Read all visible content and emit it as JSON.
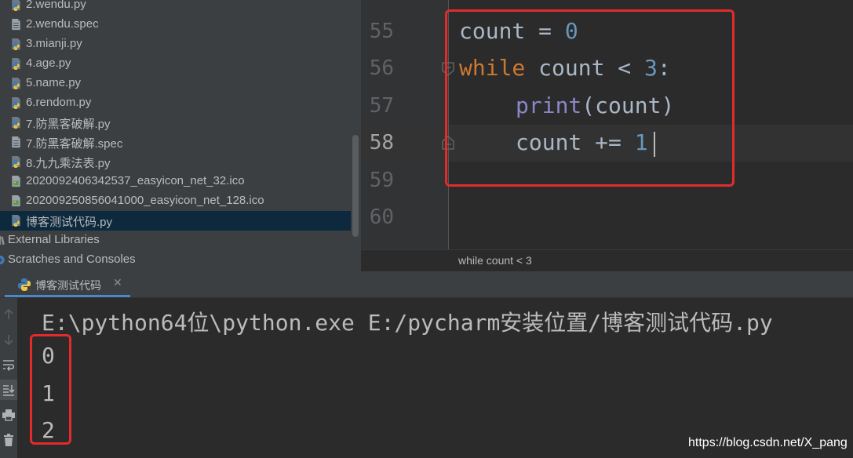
{
  "project_tree": {
    "items": [
      {
        "label": "2.wendu.py",
        "icon": "python-file-icon"
      },
      {
        "label": "2.wendu.spec",
        "icon": "text-file-icon"
      },
      {
        "label": "3.mianji.py",
        "icon": "python-file-icon"
      },
      {
        "label": "4.age.py",
        "icon": "python-file-icon"
      },
      {
        "label": "5.name.py",
        "icon": "python-file-icon"
      },
      {
        "label": "6.rendom.py",
        "icon": "python-file-icon"
      },
      {
        "label": "7.防黑客破解.py",
        "icon": "python-file-icon"
      },
      {
        "label": "7.防黑客破解.spec",
        "icon": "text-file-icon"
      },
      {
        "label": "8.九九乘法表.py",
        "icon": "python-file-icon"
      },
      {
        "label": "2020092406342537_easyicon_net_32.ico",
        "icon": "ico-file-icon"
      },
      {
        "label": "20200925085604100​0_easyicon_net_128.ico",
        "icon": "ico-file-icon"
      },
      {
        "label": "博客测试代码.py",
        "icon": "python-file-icon",
        "selected": true
      },
      {
        "label": "External Libraries",
        "icon": "library-icon"
      },
      {
        "label": "Scratches and Consoles",
        "icon": "scratches-icon"
      }
    ]
  },
  "editor": {
    "line_numbers": [
      "55",
      "56",
      "57",
      "58",
      "59",
      "60"
    ],
    "current_line": "58",
    "code": {
      "line55": {
        "var": "count",
        "op": " = ",
        "num": "0"
      },
      "line56": {
        "kw": "while",
        "rest": " count < ",
        "num": "3",
        "tail": ":"
      },
      "line57": {
        "builtin": "print",
        "rest": "(count)"
      },
      "line58": {
        "var": "count",
        "op": " += ",
        "num": "1"
      }
    },
    "breadcrumb": "while count < 3"
  },
  "run": {
    "tab_label": "博客测试代码",
    "close_glyph": "✕",
    "command": "E:\\python64位\\python.exe E:/pycharm安装位置/博客测试代码.py",
    "output": [
      "0",
      "1",
      "2"
    ],
    "toolbar": [
      "up-arrow-icon",
      "down-arrow-icon",
      "soft-wrap-icon",
      "scroll-to-end-icon",
      "print-icon",
      "trash-icon"
    ]
  },
  "colors": {
    "keyword": "#cc7832",
    "number": "#6897bb",
    "builtin": "#8888c6",
    "highlight_box": "#e32b2b",
    "selection": "#0d293e"
  },
  "watermark": "https://blog.csdn.net/X_pang"
}
